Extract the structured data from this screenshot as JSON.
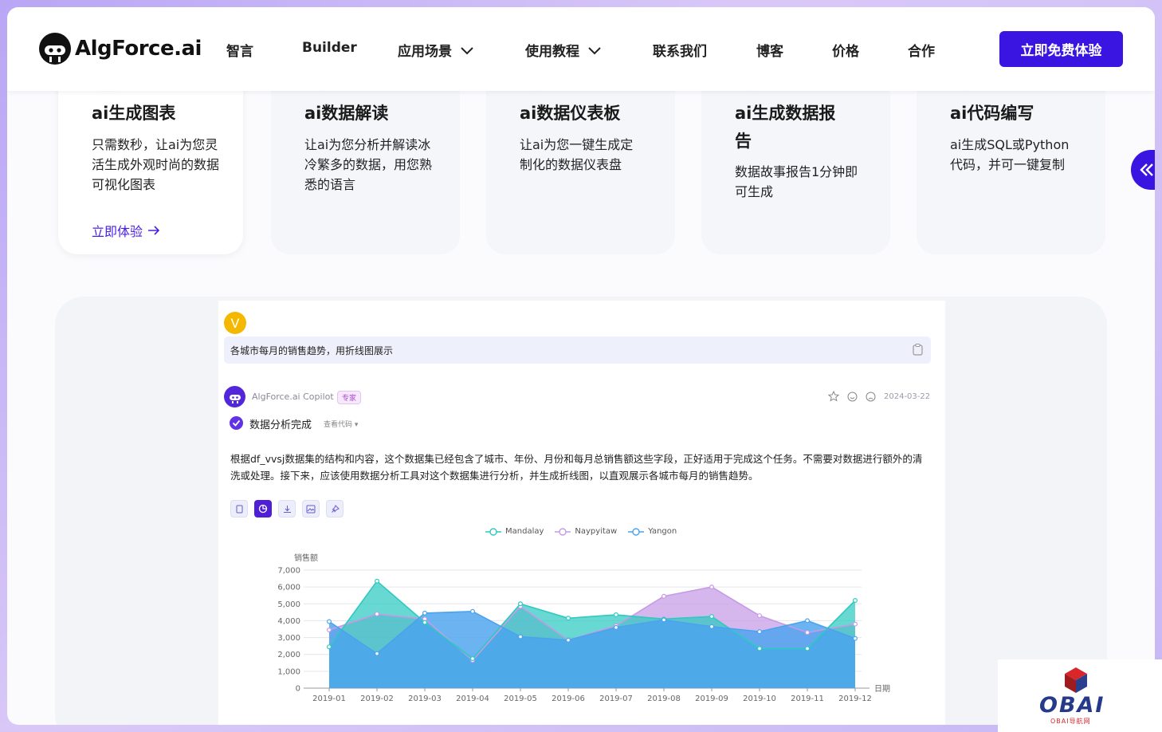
{
  "header": {
    "brand": "AlgForce.ai",
    "nav": [
      {
        "label": "智言",
        "dropdown": false
      },
      {
        "label": "Builder",
        "dropdown": false
      },
      {
        "label": "应用场景",
        "dropdown": true
      },
      {
        "label": "使用教程",
        "dropdown": true
      },
      {
        "label": "联系我们",
        "dropdown": false
      },
      {
        "label": "博客",
        "dropdown": false
      },
      {
        "label": "价格",
        "dropdown": false
      },
      {
        "label": "合作",
        "dropdown": false
      }
    ],
    "cta": "立即免费体验"
  },
  "cards": [
    {
      "title": "ai生成图表",
      "desc": "只需数秒，让ai为您灵活生成外观时尚的数据可视化图表",
      "link": "立即体验"
    },
    {
      "title": "ai数据解读",
      "desc": "让ai为您分析并解读冰冷繁多的数据，用您熟悉的语言"
    },
    {
      "title": "ai数据仪表板",
      "desc": "让ai为您一键生成定制化的数据仪表盘"
    },
    {
      "title": "ai生成数据报告",
      "desc": "数据故事报告1分钟即可生成"
    },
    {
      "title": "ai代码编写",
      "desc": "ai生成SQL或Python代码，并可一键复制"
    }
  ],
  "demo": {
    "user_initial": "V",
    "prompt": "各城市每月的销售趋势，用折线图展示",
    "bot_name": "AlgForce.ai Copilot",
    "bot_badge": "专家",
    "date": "2024-03-22",
    "status": "数据分析完成",
    "view_code": "查看代码",
    "answer": "根据df_vvsj数据集的结构和内容，这个数据集已经包含了城市、年份、月份和每月总销售额这些字段，正好适用于完成这个任务。不需要对数据进行额外的清洗或处理。接下来，应该使用数据分析工具对这个数据集进行分析，并生成折线图，以直观展示各城市每月的销售趋势。"
  },
  "colors": {
    "brand": "#3a14e0",
    "mandalay": "#2ec9c0",
    "naypyitaw": "#c59be6",
    "yangon": "#4aa3ee"
  },
  "watermark": {
    "title": "OBAI",
    "subtitle": "OBAI导航网"
  },
  "chart_data": {
    "type": "area",
    "title": "",
    "xlabel": "日期",
    "ylabel": "销售额",
    "ylim": [
      0,
      7000
    ],
    "yticks": [
      "0",
      "1,000",
      "2,000",
      "3,000",
      "4,000",
      "5,000",
      "6,000",
      "7,000"
    ],
    "categories": [
      "2019-01",
      "2019-02",
      "2019-03",
      "2019-04",
      "2019-05",
      "2019-06",
      "2019-07",
      "2019-08",
      "2019-09",
      "2019-10",
      "2019-11",
      "2019-12"
    ],
    "legend_position": "top",
    "series": [
      {
        "name": "Mandalay",
        "values": [
          2450,
          6350,
          3900,
          1750,
          5000,
          4150,
          4350,
          4100,
          4250,
          2350,
          2350,
          5200
        ]
      },
      {
        "name": "Naypyitaw",
        "values": [
          3450,
          4400,
          4100,
          1650,
          4850,
          2850,
          3700,
          5450,
          6000,
          4300,
          3300,
          3800
        ]
      },
      {
        "name": "Yangon",
        "values": [
          3950,
          2050,
          4450,
          4550,
          3050,
          2850,
          3600,
          4050,
          3650,
          3350,
          4000,
          2950
        ]
      }
    ]
  }
}
